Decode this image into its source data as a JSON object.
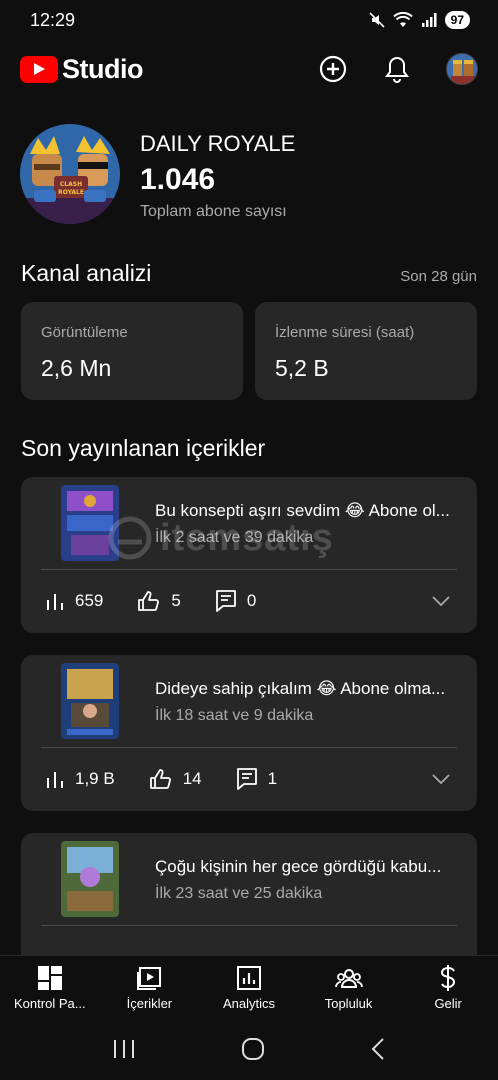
{
  "status_bar": {
    "time": "12:29",
    "battery": "97"
  },
  "app": {
    "logo_text": "Studio",
    "brand_color": "#ff0000"
  },
  "channel": {
    "name": "DAILY ROYALE",
    "subscriber_count": "1.046",
    "subscriber_label": "Toplam abone sayısı"
  },
  "analytics": {
    "title": "Kanal analizi",
    "period": "Son 28 gün",
    "cards": [
      {
        "label": "Görüntüleme",
        "value": "2,6 Mn"
      },
      {
        "label": "İzlenme süresi (saat)",
        "value": "5,2 B"
      }
    ]
  },
  "recent": {
    "title": "Son yayınlanan içerikler",
    "items": [
      {
        "title": "Bu konsepti aşırı sevdim 😂 Abone ol...",
        "time": "İlk 2 saat ve 39 dakika",
        "views": "659",
        "likes": "5",
        "comments": "0"
      },
      {
        "title": "Dideye sahip çıkalım 😂 Abone olma...",
        "time": "İlk 18 saat ve 9 dakika",
        "views": "1,9 B",
        "likes": "14",
        "comments": "1"
      },
      {
        "title": "Çoğu kişinin her gece gördüğü kabu...",
        "time": "İlk 23 saat ve 25 dakika"
      }
    ]
  },
  "watermark": {
    "text": "itemsatış"
  },
  "bottom_nav": [
    {
      "label": "Kontrol Pa...",
      "icon": "dashboard-icon"
    },
    {
      "label": "İçerikler",
      "icon": "content-icon"
    },
    {
      "label": "Analytics",
      "icon": "analytics-icon"
    },
    {
      "label": "Topluluk",
      "icon": "community-icon"
    },
    {
      "label": "Gelir",
      "icon": "earn-icon"
    }
  ]
}
